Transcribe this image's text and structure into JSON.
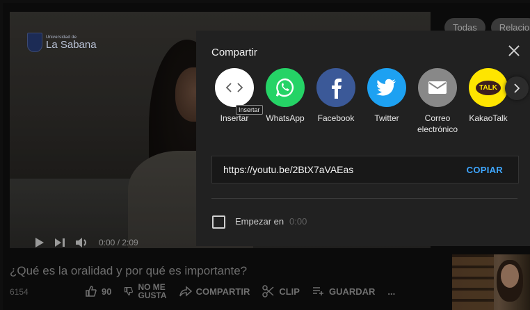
{
  "video": {
    "logo_small": "Universidad de",
    "logo_big": "La Sabana",
    "time": "0:00 / 2:09",
    "title": "¿Qué es la oralidad y por qué es importante?",
    "views": "6154"
  },
  "chips": [
    "Todas",
    "Relacio"
  ],
  "actions": {
    "like_count": "90",
    "dislike_line1": "NO ME",
    "dislike_line2": "GUSTA",
    "share": "COMPARTIR",
    "clip": "CLIP",
    "save": "GUARDAR",
    "more": "..."
  },
  "share": {
    "title": "Compartir",
    "tooltip": "Insertar",
    "items": [
      {
        "label": "Insertar",
        "color": "#ffffff",
        "icon": "embed-icon"
      },
      {
        "label": "WhatsApp",
        "color": "#25d366",
        "icon": "whatsapp-icon"
      },
      {
        "label": "Facebook",
        "color": "#3b5998",
        "icon": "facebook-icon"
      },
      {
        "label": "Twitter",
        "color": "#1da1f2",
        "icon": "twitter-icon"
      },
      {
        "label": "Correo electrónico",
        "color": "#888888",
        "icon": "mail-icon"
      },
      {
        "label": "KakaoTalk",
        "color": "#fee500",
        "icon": "kakaotalk-icon"
      }
    ],
    "kakao_text": "TALK",
    "url": "https://youtu.be/2BtX7aVAEas",
    "copy_label": "COPIAR",
    "start_label": "Empezar en",
    "start_time": "0:00"
  }
}
